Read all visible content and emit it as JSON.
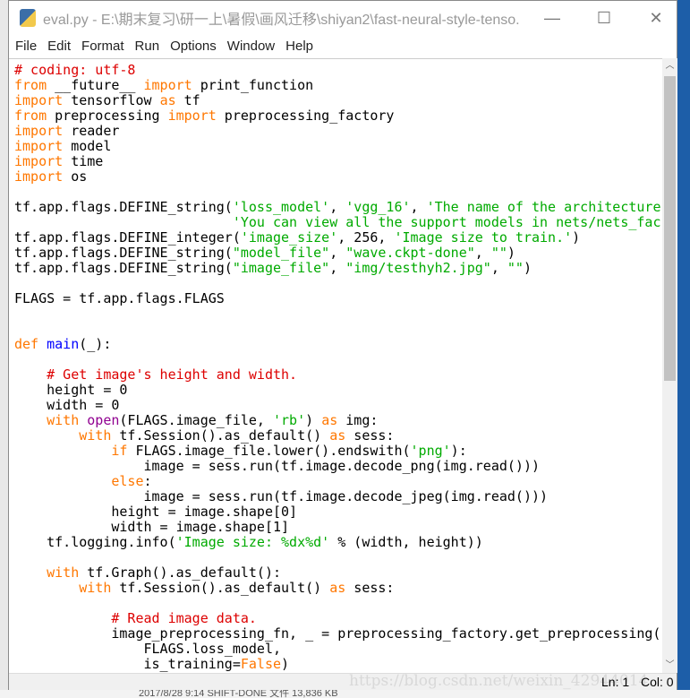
{
  "window": {
    "title": "eval.py - E:\\期末复习\\研一上\\暑假\\画风迁移\\shiyan2\\fast-neural-style-tenso...",
    "minimize": "—",
    "maximize": "☐",
    "close": "✕"
  },
  "menu": [
    "File",
    "Edit",
    "Format",
    "Run",
    "Options",
    "Window",
    "Help"
  ],
  "colors": {
    "keyword": "#ff7700",
    "string": "#00aa00",
    "comment": "#dd0000",
    "builtin": "#900090",
    "definition": "#0000ff"
  },
  "code": [
    [
      [
        "c",
        "# coding: utf-8"
      ]
    ],
    [
      [
        "k",
        "from"
      ],
      [
        "n",
        " __future__ "
      ],
      [
        "k",
        "import"
      ],
      [
        "n",
        " print_function"
      ]
    ],
    [
      [
        "k",
        "import"
      ],
      [
        "n",
        " tensorflow "
      ],
      [
        "k",
        "as"
      ],
      [
        "n",
        " tf"
      ]
    ],
    [
      [
        "k",
        "from"
      ],
      [
        "n",
        " preprocessing "
      ],
      [
        "k",
        "import"
      ],
      [
        "n",
        " preprocessing_factory"
      ]
    ],
    [
      [
        "k",
        "import"
      ],
      [
        "n",
        " reader"
      ]
    ],
    [
      [
        "k",
        "import"
      ],
      [
        "n",
        " model"
      ]
    ],
    [
      [
        "k",
        "import"
      ],
      [
        "n",
        " time"
      ]
    ],
    [
      [
        "k",
        "import"
      ],
      [
        "n",
        " os"
      ]
    ],
    [],
    [
      [
        "n",
        "tf.app.flags.DEFINE_string("
      ],
      [
        "s",
        "'loss_model'"
      ],
      [
        "n",
        ", "
      ],
      [
        "s",
        "'vgg_16'"
      ],
      [
        "n",
        ", "
      ],
      [
        "s",
        "'The name of the architecture"
      ]
    ],
    [
      [
        "n",
        "                           "
      ],
      [
        "s",
        "'You can view all the support models in nets/nets_fac"
      ]
    ],
    [
      [
        "n",
        "tf.app.flags.DEFINE_integer("
      ],
      [
        "s",
        "'image_size'"
      ],
      [
        "n",
        ", 256, "
      ],
      [
        "s",
        "'Image size to train.'"
      ],
      [
        "n",
        ")"
      ]
    ],
    [
      [
        "n",
        "tf.app.flags.DEFINE_string("
      ],
      [
        "s",
        "\"model_file\""
      ],
      [
        "n",
        ", "
      ],
      [
        "s",
        "\"wave.ckpt-done\""
      ],
      [
        "n",
        ", "
      ],
      [
        "s",
        "\"\""
      ],
      [
        "n",
        ")"
      ]
    ],
    [
      [
        "n",
        "tf.app.flags.DEFINE_string("
      ],
      [
        "s",
        "\"image_file\""
      ],
      [
        "n",
        ", "
      ],
      [
        "s",
        "\"img/testhyh2.jpg\""
      ],
      [
        "n",
        ", "
      ],
      [
        "s",
        "\"\""
      ],
      [
        "n",
        ")"
      ]
    ],
    [],
    [
      [
        "n",
        "FLAGS = tf.app.flags.FLAGS"
      ]
    ],
    [],
    [],
    [
      [
        "k",
        "def"
      ],
      [
        "n",
        " "
      ],
      [
        "d",
        "main"
      ],
      [
        "n",
        "(_):"
      ]
    ],
    [],
    [
      [
        "n",
        "    "
      ],
      [
        "c",
        "# Get image's height and width."
      ]
    ],
    [
      [
        "n",
        "    height = 0"
      ]
    ],
    [
      [
        "n",
        "    width = 0"
      ]
    ],
    [
      [
        "n",
        "    "
      ],
      [
        "k",
        "with"
      ],
      [
        "n",
        " "
      ],
      [
        "b",
        "open"
      ],
      [
        "n",
        "(FLAGS.image_file, "
      ],
      [
        "s",
        "'rb'"
      ],
      [
        "n",
        ") "
      ],
      [
        "k",
        "as"
      ],
      [
        "n",
        " img:"
      ]
    ],
    [
      [
        "n",
        "        "
      ],
      [
        "k",
        "with"
      ],
      [
        "n",
        " tf.Session().as_default() "
      ],
      [
        "k",
        "as"
      ],
      [
        "n",
        " sess:"
      ]
    ],
    [
      [
        "n",
        "            "
      ],
      [
        "k",
        "if"
      ],
      [
        "n",
        " FLAGS.image_file.lower().endswith("
      ],
      [
        "s",
        "'png'"
      ],
      [
        "n",
        "):"
      ]
    ],
    [
      [
        "n",
        "                image = sess.run(tf.image.decode_png(img.read()))"
      ]
    ],
    [
      [
        "n",
        "            "
      ],
      [
        "k",
        "else"
      ],
      [
        "n",
        ":"
      ]
    ],
    [
      [
        "n",
        "                image = sess.run(tf.image.decode_jpeg(img.read()))"
      ]
    ],
    [
      [
        "n",
        "            height = image.shape[0]"
      ]
    ],
    [
      [
        "n",
        "            width = image.shape[1]"
      ]
    ],
    [
      [
        "n",
        "    tf.logging.info("
      ],
      [
        "s",
        "'Image size: %dx%d'"
      ],
      [
        "n",
        " % (width, height))"
      ]
    ],
    [],
    [
      [
        "n",
        "    "
      ],
      [
        "k",
        "with"
      ],
      [
        "n",
        " tf.Graph().as_default():"
      ]
    ],
    [
      [
        "n",
        "        "
      ],
      [
        "k",
        "with"
      ],
      [
        "n",
        " tf.Session().as_default() "
      ],
      [
        "k",
        "as"
      ],
      [
        "n",
        " sess:"
      ]
    ],
    [],
    [
      [
        "n",
        "            "
      ],
      [
        "c",
        "# Read image data."
      ]
    ],
    [
      [
        "n",
        "            image_preprocessing_fn, _ = preprocessing_factory.get_preprocessing("
      ]
    ],
    [
      [
        "n",
        "                FLAGS.loss_model,"
      ]
    ],
    [
      [
        "n",
        "                is_training="
      ],
      [
        "k",
        "False"
      ],
      [
        "n",
        ")"
      ]
    ]
  ],
  "status": {
    "ln": "Ln: 1",
    "col": "Col: 0",
    "watermark": "https://blog.csdn.net/weixin_42944014"
  },
  "background": {
    "taskbar_text": "2017/8/28 9:14      SHIFT-DONE 文件        13,836 KB"
  }
}
